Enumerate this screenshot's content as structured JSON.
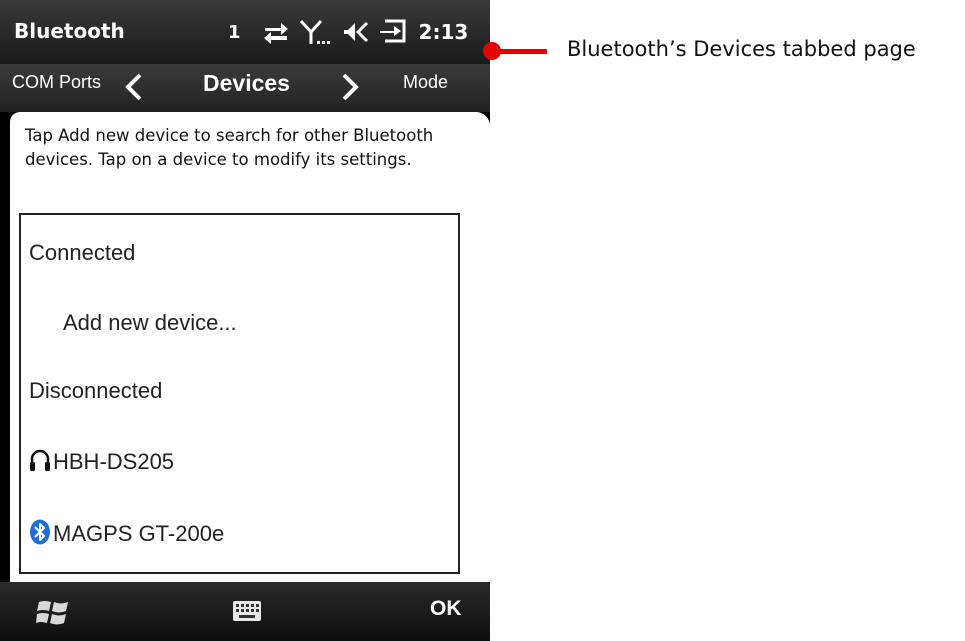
{
  "status_bar": {
    "title": "Bluetooth",
    "signal_number": "1",
    "time": "2:13",
    "icons": [
      "data-transfer-icon",
      "antenna-icon",
      "speaker-icon",
      "charging-icon"
    ]
  },
  "tabs": {
    "prev_label": "COM Ports",
    "current_label": "Devices",
    "next_label": "Mode"
  },
  "description": "Tap Add new device to search for other Bluetooth devices. Tap on a device to modify its settings.",
  "device_list": {
    "connected_header": "Connected",
    "add_new_label": "Add new device...",
    "disconnected_header": "Disconnected",
    "devices": [
      {
        "name": "HBH-DS205",
        "icon": "headset-icon"
      },
      {
        "name": "MAGPS GT-200e",
        "icon": "bluetooth-icon"
      }
    ]
  },
  "soft_keys": {
    "start_icon": "windows-logo-icon",
    "keyboard_icon": "keyboard-icon",
    "ok_label": "OK"
  },
  "annotation": {
    "text": "Bluetooth’s Devices tabbed page",
    "color": "#e30000"
  }
}
